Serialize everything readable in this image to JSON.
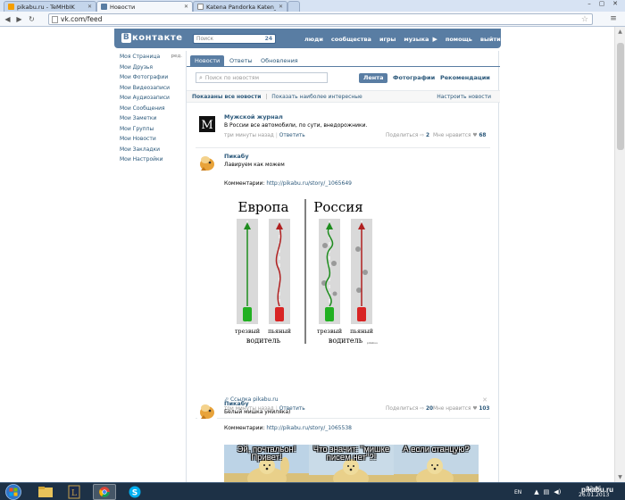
{
  "browser": {
    "tabs": [
      {
        "title": "pikabu.ru - TeMHbIK",
        "color": "#f59f00"
      },
      {
        "title": "Новости",
        "color": "#597da3"
      },
      {
        "title": "Katena Pandorka Katen_ei",
        "color": "#888888"
      }
    ],
    "url": "vk.com/feed"
  },
  "vk": {
    "logo_text": "контакте",
    "logo_letter": "В",
    "search_placeholder": "Поиск",
    "search_count": "24",
    "menu": [
      "люди",
      "сообщества",
      "игры",
      "музыка",
      "помощь",
      "выйти"
    ],
    "left_menu": [
      {
        "label": "Моя Страница",
        "edit": "ред."
      },
      {
        "label": "Мои Друзья"
      },
      {
        "label": "Мои Фотографии"
      },
      {
        "label": "Мои Видеозаписи"
      },
      {
        "label": "Мои Аудиозаписи"
      },
      {
        "label": "Мои Сообщения"
      },
      {
        "label": "Мои Заметки"
      },
      {
        "label": "Мои Группы"
      },
      {
        "label": "Мои Новости"
      },
      {
        "label": "Мои Закладки"
      },
      {
        "label": "Мои Настройки"
      }
    ],
    "feed_tabs": [
      "Новости",
      "Ответы",
      "Обновления"
    ],
    "feed_search_placeholder": "Поиск по новостям",
    "feed_views": [
      "Лента",
      "Фотографии",
      "Рекомендации"
    ],
    "shown_all": "Показаны все новости",
    "shown_sep": "|",
    "show_interesting": "Показать наиболее интересные",
    "settings": "Настроить новости"
  },
  "posts": [
    {
      "author": "Мужской журнал",
      "text": "В России все автомобили, по сути, внедорожники.",
      "ago": "три минуты назад",
      "comment": "Ответить",
      "share_label": "Поделиться",
      "share_count": "2",
      "like_label": "Мне нравится",
      "like_count": "68",
      "avatar_letter": "M"
    },
    {
      "author": "Пикабу",
      "text": "Лавируем как можем",
      "link_label": "Комментарии:",
      "link_url": "http://pikabu.ru/story/_1065649",
      "image": {
        "left_title": "Европа",
        "right_title": "Россия",
        "sober": "трезвый",
        "drunk": "пьяный",
        "driver": "водитель",
        "signature": "pikabuu"
      },
      "source": "Ссылка pikabu.ru",
      "ago": "три минуты назад",
      "comment": "Ответить",
      "share_label": "Поделиться",
      "share_count": "20",
      "like_label": "Мне нравится",
      "like_count": "103"
    },
    {
      "author": "Пикабу",
      "text": "Белый мишка умиляка)",
      "link_label": "Комментарии:",
      "link_url": "http://pikabu.ru/story/_1065538",
      "close": "✕",
      "meme": [
        "Эй, почтальон! Привет!",
        "Что значит: \"мишке писем нет\"?!",
        "А если станцую?"
      ]
    }
  ],
  "taskbar": {
    "lang": "EN",
    "time": "12:05",
    "date": "26.01.2013",
    "watermark": "pikabu.ru"
  }
}
